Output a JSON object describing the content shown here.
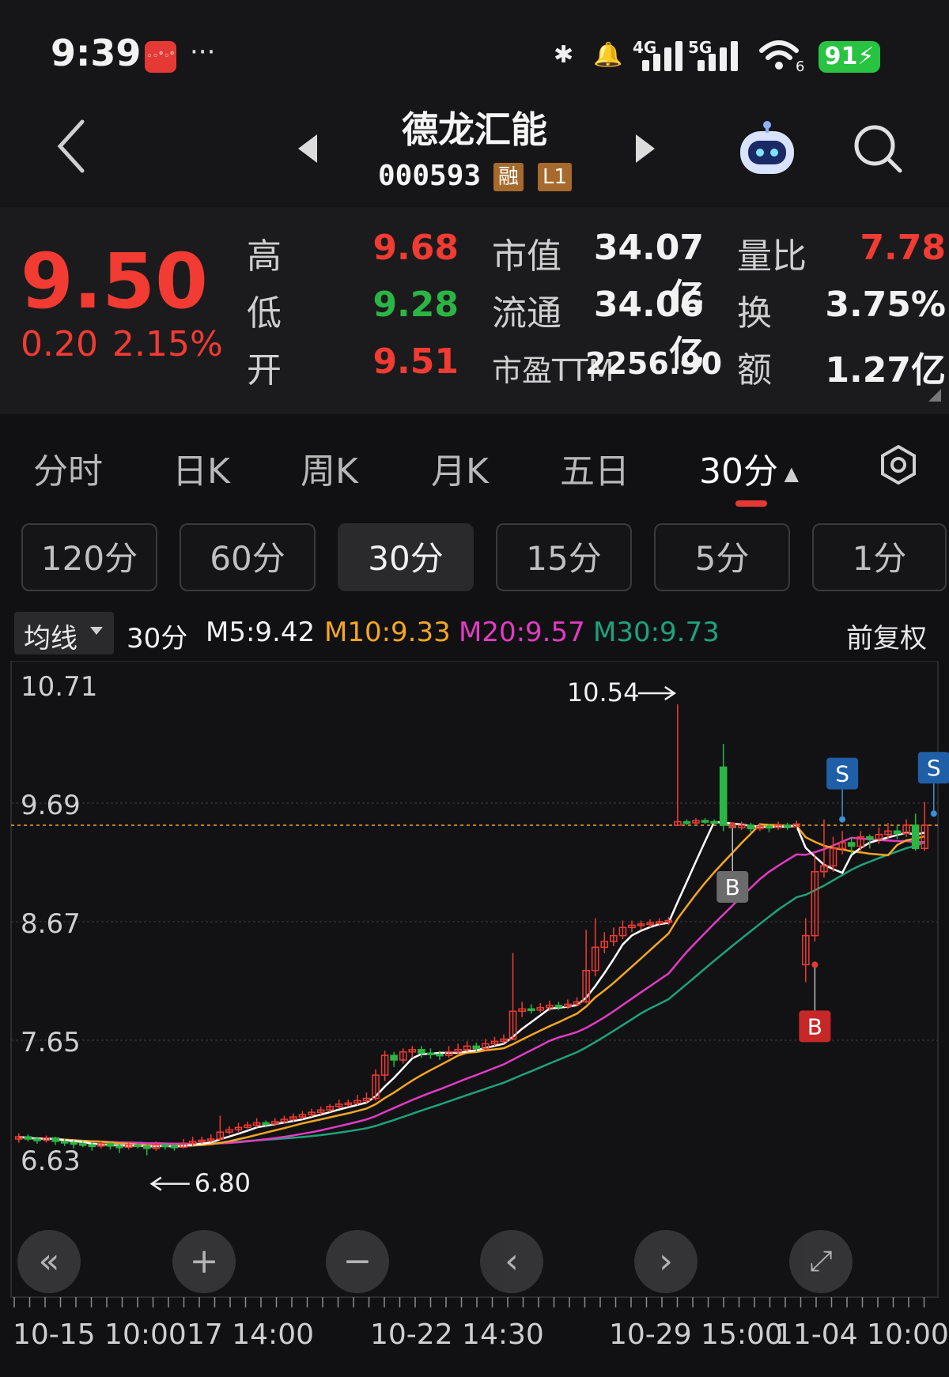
{
  "status_bar": {
    "time": "9:39",
    "app_badge": "◦◦°◦°",
    "more": "···",
    "net_4g": "4G",
    "net_5g": "5G",
    "wifi_level": "6",
    "battery": "91",
    "icons": [
      "bluetooth-icon",
      "alarm-icon",
      "signal-icon",
      "wifi-icon",
      "battery-icon"
    ]
  },
  "header": {
    "stock_name": "德龙汇能",
    "stock_code": "000593",
    "tags": [
      "融",
      "L1"
    ],
    "icons": [
      "back-icon",
      "prev-stock-icon",
      "next-stock-icon",
      "robot-icon",
      "search-icon"
    ]
  },
  "quote": {
    "price": "9.50",
    "change": "0.20",
    "change_pct": "2.15%",
    "high_label": "高",
    "high": "9.68",
    "low_label": "低",
    "low": "9.28",
    "open_label": "开",
    "open": "9.51",
    "mktcap_label": "市值",
    "mktcap": "34.07亿",
    "float_label": "流通",
    "float": "34.06亿",
    "pe_label": "市盈TTM",
    "pe": "2256.90",
    "vol_ratio_label": "量比",
    "vol_ratio": "7.78",
    "turnover_label": "换",
    "turnover": "3.75%",
    "amount_label": "额",
    "amount": "1.27亿"
  },
  "tabs": [
    "分时",
    "日K",
    "周K",
    "月K",
    "五日",
    "30分"
  ],
  "active_tab": "30分",
  "periods": [
    "120分",
    "60分",
    "30分",
    "15分",
    "5分",
    "1分"
  ],
  "active_period": "30分",
  "indicators": {
    "ma_select": "均线",
    "period": "30分",
    "m5": "M5:9.42",
    "m10": "M10:9.33",
    "m20": "M20:9.57",
    "m30": "M30:9.73",
    "adjust": "前复权",
    "colors": {
      "m5": "#ffffff",
      "m10": "#f5a623",
      "m20": "#e23bc4",
      "m30": "#1fa37a",
      "up": "#f23b32",
      "down": "#2bb544"
    }
  },
  "chart_data": {
    "type": "candlestick",
    "y_ticks": [
      "10.71",
      "9.69",
      "8.67",
      "7.65",
      "6.63"
    ],
    "ylim": [
      6.63,
      10.71
    ],
    "max_label": "10.54",
    "min_label": "6.80",
    "x_ticks": [
      "10-15 10:00",
      "17 14:00",
      "10-22 14:30",
      "10-29 15:00",
      "11-04 10:00"
    ],
    "current_price": 9.5,
    "candles": [
      [
        6.8,
        6.82,
        6.85,
        6.77
      ],
      [
        6.82,
        6.8,
        6.84,
        6.78
      ],
      [
        6.8,
        6.79,
        6.82,
        6.76
      ],
      [
        6.79,
        6.81,
        6.83,
        6.77
      ],
      [
        6.81,
        6.78,
        6.82,
        6.75
      ],
      [
        6.78,
        6.77,
        6.8,
        6.74
      ],
      [
        6.77,
        6.76,
        6.79,
        6.72
      ],
      [
        6.76,
        6.75,
        6.78,
        6.73
      ],
      [
        6.75,
        6.74,
        6.77,
        6.7
      ],
      [
        6.74,
        6.76,
        6.78,
        6.72
      ],
      [
        6.76,
        6.74,
        6.77,
        6.71
      ],
      [
        6.74,
        6.73,
        6.76,
        6.68
      ],
      [
        6.73,
        6.75,
        6.77,
        6.71
      ],
      [
        6.75,
        6.74,
        6.76,
        6.72
      ],
      [
        6.74,
        6.72,
        6.75,
        6.66
      ],
      [
        6.72,
        6.75,
        6.78,
        6.7
      ],
      [
        6.75,
        6.74,
        6.77,
        6.71
      ],
      [
        6.74,
        6.73,
        6.76,
        6.7
      ],
      [
        6.73,
        6.76,
        6.8,
        6.72
      ],
      [
        6.76,
        6.78,
        6.82,
        6.74
      ],
      [
        6.78,
        6.79,
        6.82,
        6.76
      ],
      [
        6.79,
        6.8,
        6.84,
        6.77
      ],
      [
        6.8,
        6.86,
        7.0,
        6.79
      ],
      [
        6.86,
        6.88,
        6.91,
        6.84
      ],
      [
        6.88,
        6.9,
        6.94,
        6.86
      ],
      [
        6.9,
        6.92,
        6.95,
        6.89
      ],
      [
        6.92,
        6.94,
        6.98,
        6.9
      ],
      [
        6.94,
        6.93,
        6.96,
        6.9
      ],
      [
        6.93,
        6.95,
        6.98,
        6.91
      ],
      [
        6.95,
        6.97,
        7.0,
        6.93
      ],
      [
        6.97,
        6.99,
        7.02,
        6.95
      ],
      [
        6.99,
        7.01,
        7.04,
        6.97
      ],
      [
        7.01,
        7.03,
        7.06,
        6.99
      ],
      [
        7.03,
        7.05,
        7.08,
        7.01
      ],
      [
        7.05,
        7.08,
        7.1,
        7.03
      ],
      [
        7.08,
        7.1,
        7.14,
        7.06
      ],
      [
        7.1,
        7.11,
        7.14,
        7.08
      ],
      [
        7.11,
        7.13,
        7.18,
        7.09
      ],
      [
        7.13,
        7.15,
        7.2,
        7.11
      ],
      [
        7.15,
        7.35,
        7.4,
        7.13
      ],
      [
        7.35,
        7.52,
        7.56,
        7.3
      ],
      [
        7.52,
        7.48,
        7.55,
        7.42
      ],
      [
        7.48,
        7.55,
        7.58,
        7.45
      ],
      [
        7.55,
        7.57,
        7.6,
        7.5
      ],
      [
        7.57,
        7.54,
        7.6,
        7.5
      ],
      [
        7.54,
        7.53,
        7.58,
        7.49
      ],
      [
        7.53,
        7.52,
        7.56,
        7.48
      ],
      [
        7.52,
        7.55,
        7.6,
        7.5
      ],
      [
        7.55,
        7.57,
        7.62,
        7.53
      ],
      [
        7.57,
        7.6,
        7.64,
        7.55
      ],
      [
        7.6,
        7.58,
        7.63,
        7.55
      ],
      [
        7.58,
        7.62,
        7.66,
        7.56
      ],
      [
        7.62,
        7.64,
        7.68,
        7.6
      ],
      [
        7.64,
        7.66,
        7.7,
        7.62
      ],
      [
        7.66,
        7.9,
        8.4,
        7.65
      ],
      [
        7.9,
        7.92,
        7.98,
        7.85
      ],
      [
        7.92,
        7.91,
        7.96,
        7.88
      ],
      [
        7.91,
        7.93,
        7.97,
        7.89
      ],
      [
        7.93,
        7.95,
        7.99,
        7.9
      ],
      [
        7.95,
        7.94,
        7.98,
        7.91
      ],
      [
        7.94,
        7.96,
        8.0,
        7.92
      ],
      [
        7.96,
        7.98,
        8.02,
        7.94
      ],
      [
        7.98,
        8.25,
        8.6,
        7.97
      ],
      [
        8.25,
        8.45,
        8.7,
        8.2
      ],
      [
        8.45,
        8.5,
        8.58,
        8.4
      ],
      [
        8.5,
        8.55,
        8.62,
        8.46
      ],
      [
        8.55,
        8.62,
        8.68,
        8.52
      ],
      [
        8.62,
        8.64,
        8.68,
        8.58
      ],
      [
        8.64,
        8.65,
        8.68,
        8.6
      ],
      [
        8.65,
        8.66,
        8.69,
        8.62
      ],
      [
        8.66,
        8.67,
        8.7,
        8.63
      ],
      [
        8.67,
        8.68,
        8.71,
        8.64
      ],
      [
        9.5,
        9.53,
        10.54,
        9.5
      ],
      [
        9.53,
        9.52,
        9.55,
        9.5
      ],
      [
        9.52,
        9.54,
        9.56,
        9.5
      ],
      [
        9.54,
        9.53,
        9.56,
        9.51
      ],
      [
        9.53,
        9.52,
        9.55,
        9.5
      ],
      [
        10.0,
        9.5,
        10.2,
        9.45
      ],
      [
        9.5,
        9.48,
        9.52,
        9.45
      ],
      [
        9.48,
        9.5,
        9.53,
        9.46
      ],
      [
        9.5,
        9.47,
        9.52,
        9.44
      ],
      [
        9.47,
        9.49,
        9.52,
        9.45
      ],
      [
        9.49,
        9.48,
        9.51,
        9.44
      ],
      [
        9.48,
        9.5,
        9.53,
        9.46
      ],
      [
        9.5,
        9.49,
        9.52,
        9.46
      ],
      [
        9.49,
        9.51,
        9.54,
        9.47
      ],
      [
        8.3,
        8.55,
        8.7,
        8.15
      ],
      [
        8.55,
        9.1,
        9.25,
        8.5
      ],
      [
        9.1,
        9.15,
        9.55,
        9.05
      ],
      [
        9.15,
        9.3,
        9.4,
        9.1
      ],
      [
        9.3,
        9.35,
        9.45,
        9.25
      ],
      [
        9.35,
        9.32,
        9.4,
        9.25
      ],
      [
        9.32,
        9.4,
        9.45,
        9.28
      ],
      [
        9.4,
        9.38,
        9.42,
        9.3
      ],
      [
        9.38,
        9.42,
        9.48,
        9.34
      ],
      [
        9.42,
        9.45,
        9.52,
        9.38
      ],
      [
        9.45,
        9.43,
        9.5,
        9.38
      ],
      [
        9.43,
        9.5,
        9.55,
        9.4
      ],
      [
        9.5,
        9.3,
        9.6,
        9.28
      ],
      [
        9.3,
        9.5,
        9.7,
        9.28
      ]
    ],
    "signals": [
      {
        "label": "B",
        "index": 78,
        "price": 9.5,
        "side": "buy"
      },
      {
        "label": "B",
        "index": 87,
        "price": 8.3,
        "side": "buy"
      },
      {
        "label": "S",
        "index": 90,
        "price": 9.55,
        "side": "sell"
      },
      {
        "label": "S",
        "index": 100,
        "price": 9.6,
        "side": "sell"
      }
    ]
  }
}
